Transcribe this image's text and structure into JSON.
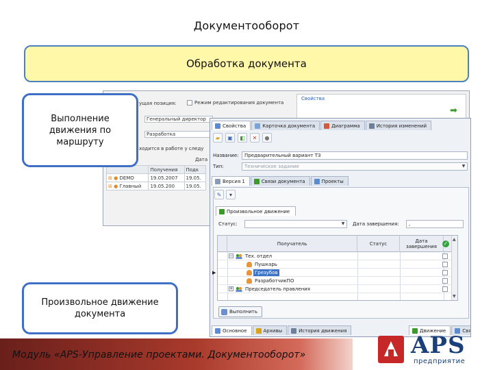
{
  "slide": {
    "title": "Документооборот",
    "banner": "Обработка  документа",
    "callout_route": "Выполнение движения по маршруту",
    "callout_free": "Произвольное движение документа",
    "footer": "Модуль «APS-Управление проектами. Документооборот»"
  },
  "logo": {
    "word": "APS",
    "sub": "предприятие",
    "mark_color": "#c62828",
    "word_color": "#1a3f7a"
  },
  "bg_window": {
    "position_label": "ущая позиция:",
    "edit_mode_label": "Режим редактирования документа",
    "field1": "Генеральный директор",
    "field2": "Разработка",
    "work_label": "ходится в работе у следу",
    "right_panel_title": "Свойства",
    "table_headers": [
      "",
      "Получения",
      "Подк"
    ],
    "table_rows": [
      [
        "DEMO",
        "19.05.2007",
        "19.05."
      ],
      [
        "Главный",
        "19.05.200",
        "19.05."
      ]
    ],
    "col_header_short": "Дата"
  },
  "main_window": {
    "tabs": [
      "Свойства",
      "Карточка документа",
      "Диаграмма",
      "История изменений"
    ],
    "name_label": "Название:",
    "name_value": "Предварительный вариант ТЗ",
    "type_label": "Тип:",
    "type_value": "Техническое задание",
    "sub_tabs": [
      "Версия 1",
      "Связи документа",
      "Проекты"
    ],
    "free_move_tab": "Произвольное движение",
    "status_label": "Статус:",
    "due_date_label": "Дата завершения:",
    "due_date_value": ",",
    "grid_headers": [
      "Получатель",
      "Статус",
      "Дата завершения"
    ],
    "grid_rows": [
      {
        "name": "Тех. отдел",
        "level": 0,
        "type": "group"
      },
      {
        "name": "Пушкарь",
        "level": 1,
        "type": "person"
      },
      {
        "name": "Грезубов",
        "level": 1,
        "type": "person",
        "selected": true
      },
      {
        "name": "РазработчикПО",
        "level": 1,
        "type": "person"
      },
      {
        "name": "Председатель правления",
        "level": 0,
        "type": "group"
      }
    ],
    "execute_button": "Выполнить",
    "bottom_tabs": [
      "Основное",
      "Архивы",
      "История движения"
    ],
    "bottom_tabs_right": [
      "Движение",
      "Связанный объект"
    ]
  }
}
